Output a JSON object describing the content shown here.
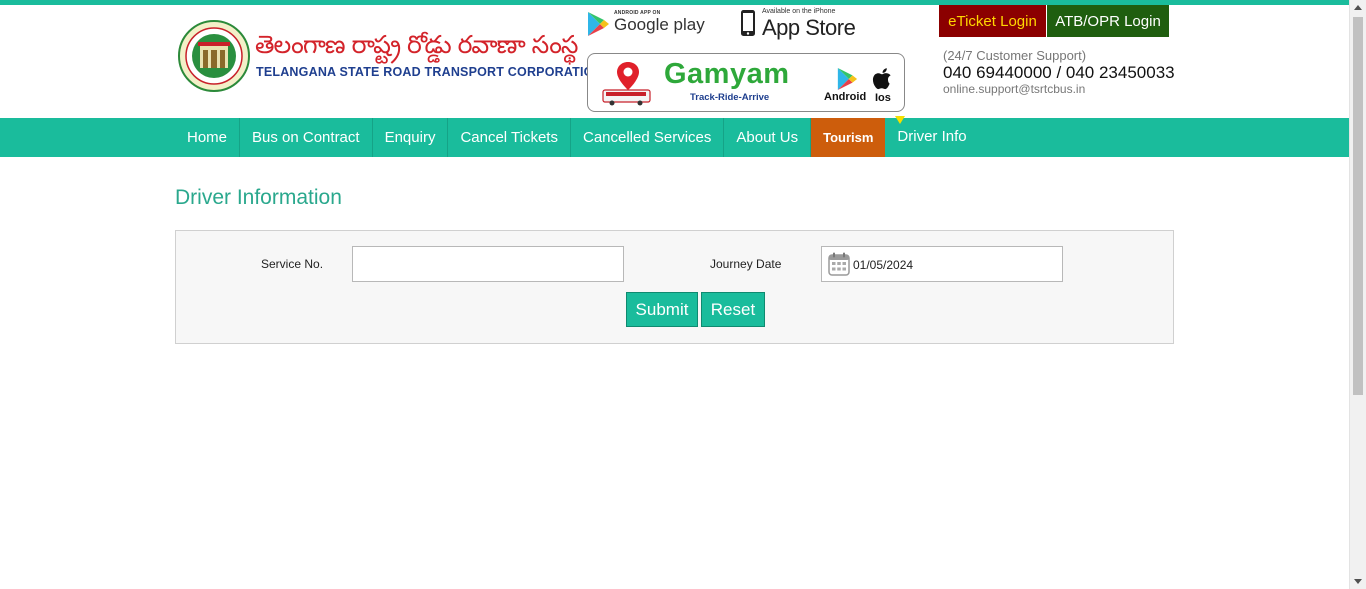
{
  "brand": {
    "telugu_name": "తెలంగాణ రాష్ట్ర రోడ్డు రవాణా సంస్థ",
    "english_name": "TELANGANA STATE ROAD TRANSPORT CORPORATION"
  },
  "apps": {
    "google_play_small": "ANDROID APP ON",
    "google_play_label": "Google play",
    "app_store_small": "Available on the iPhone",
    "app_store_label": "App Store",
    "gamyam_title": "Gamyam",
    "gamyam_tagline": "Track-Ride-Arrive",
    "gamyam_android": "Android",
    "gamyam_ios": "Ios"
  },
  "header": {
    "eticket_login": "eTicket Login",
    "atb_login": "ATB/OPR Login",
    "support_label": "(24/7 Customer Support)",
    "phones": "040 69440000 / 040 23450033",
    "email": "online.support@tsrtcbus.in"
  },
  "nav": {
    "items": [
      "Home",
      "Bus on Contract",
      "Enquiry",
      "Cancel Tickets",
      "Cancelled Services",
      "About Us",
      "Tourism",
      "Driver Info"
    ]
  },
  "page": {
    "title": "Driver Information"
  },
  "form": {
    "service_label": "Service No.",
    "service_value": "",
    "journey_label": "Journey Date",
    "journey_value": "01/05/2024",
    "submit_label": "Submit",
    "reset_label": "Reset"
  },
  "colors": {
    "primary": "#1abc9c",
    "tourism": "#cd5d0c",
    "eticket_bg": "#8b0000",
    "eticket_text": "#ffd700",
    "atb_bg": "#1f5e0f",
    "title": "#2aa88d"
  }
}
